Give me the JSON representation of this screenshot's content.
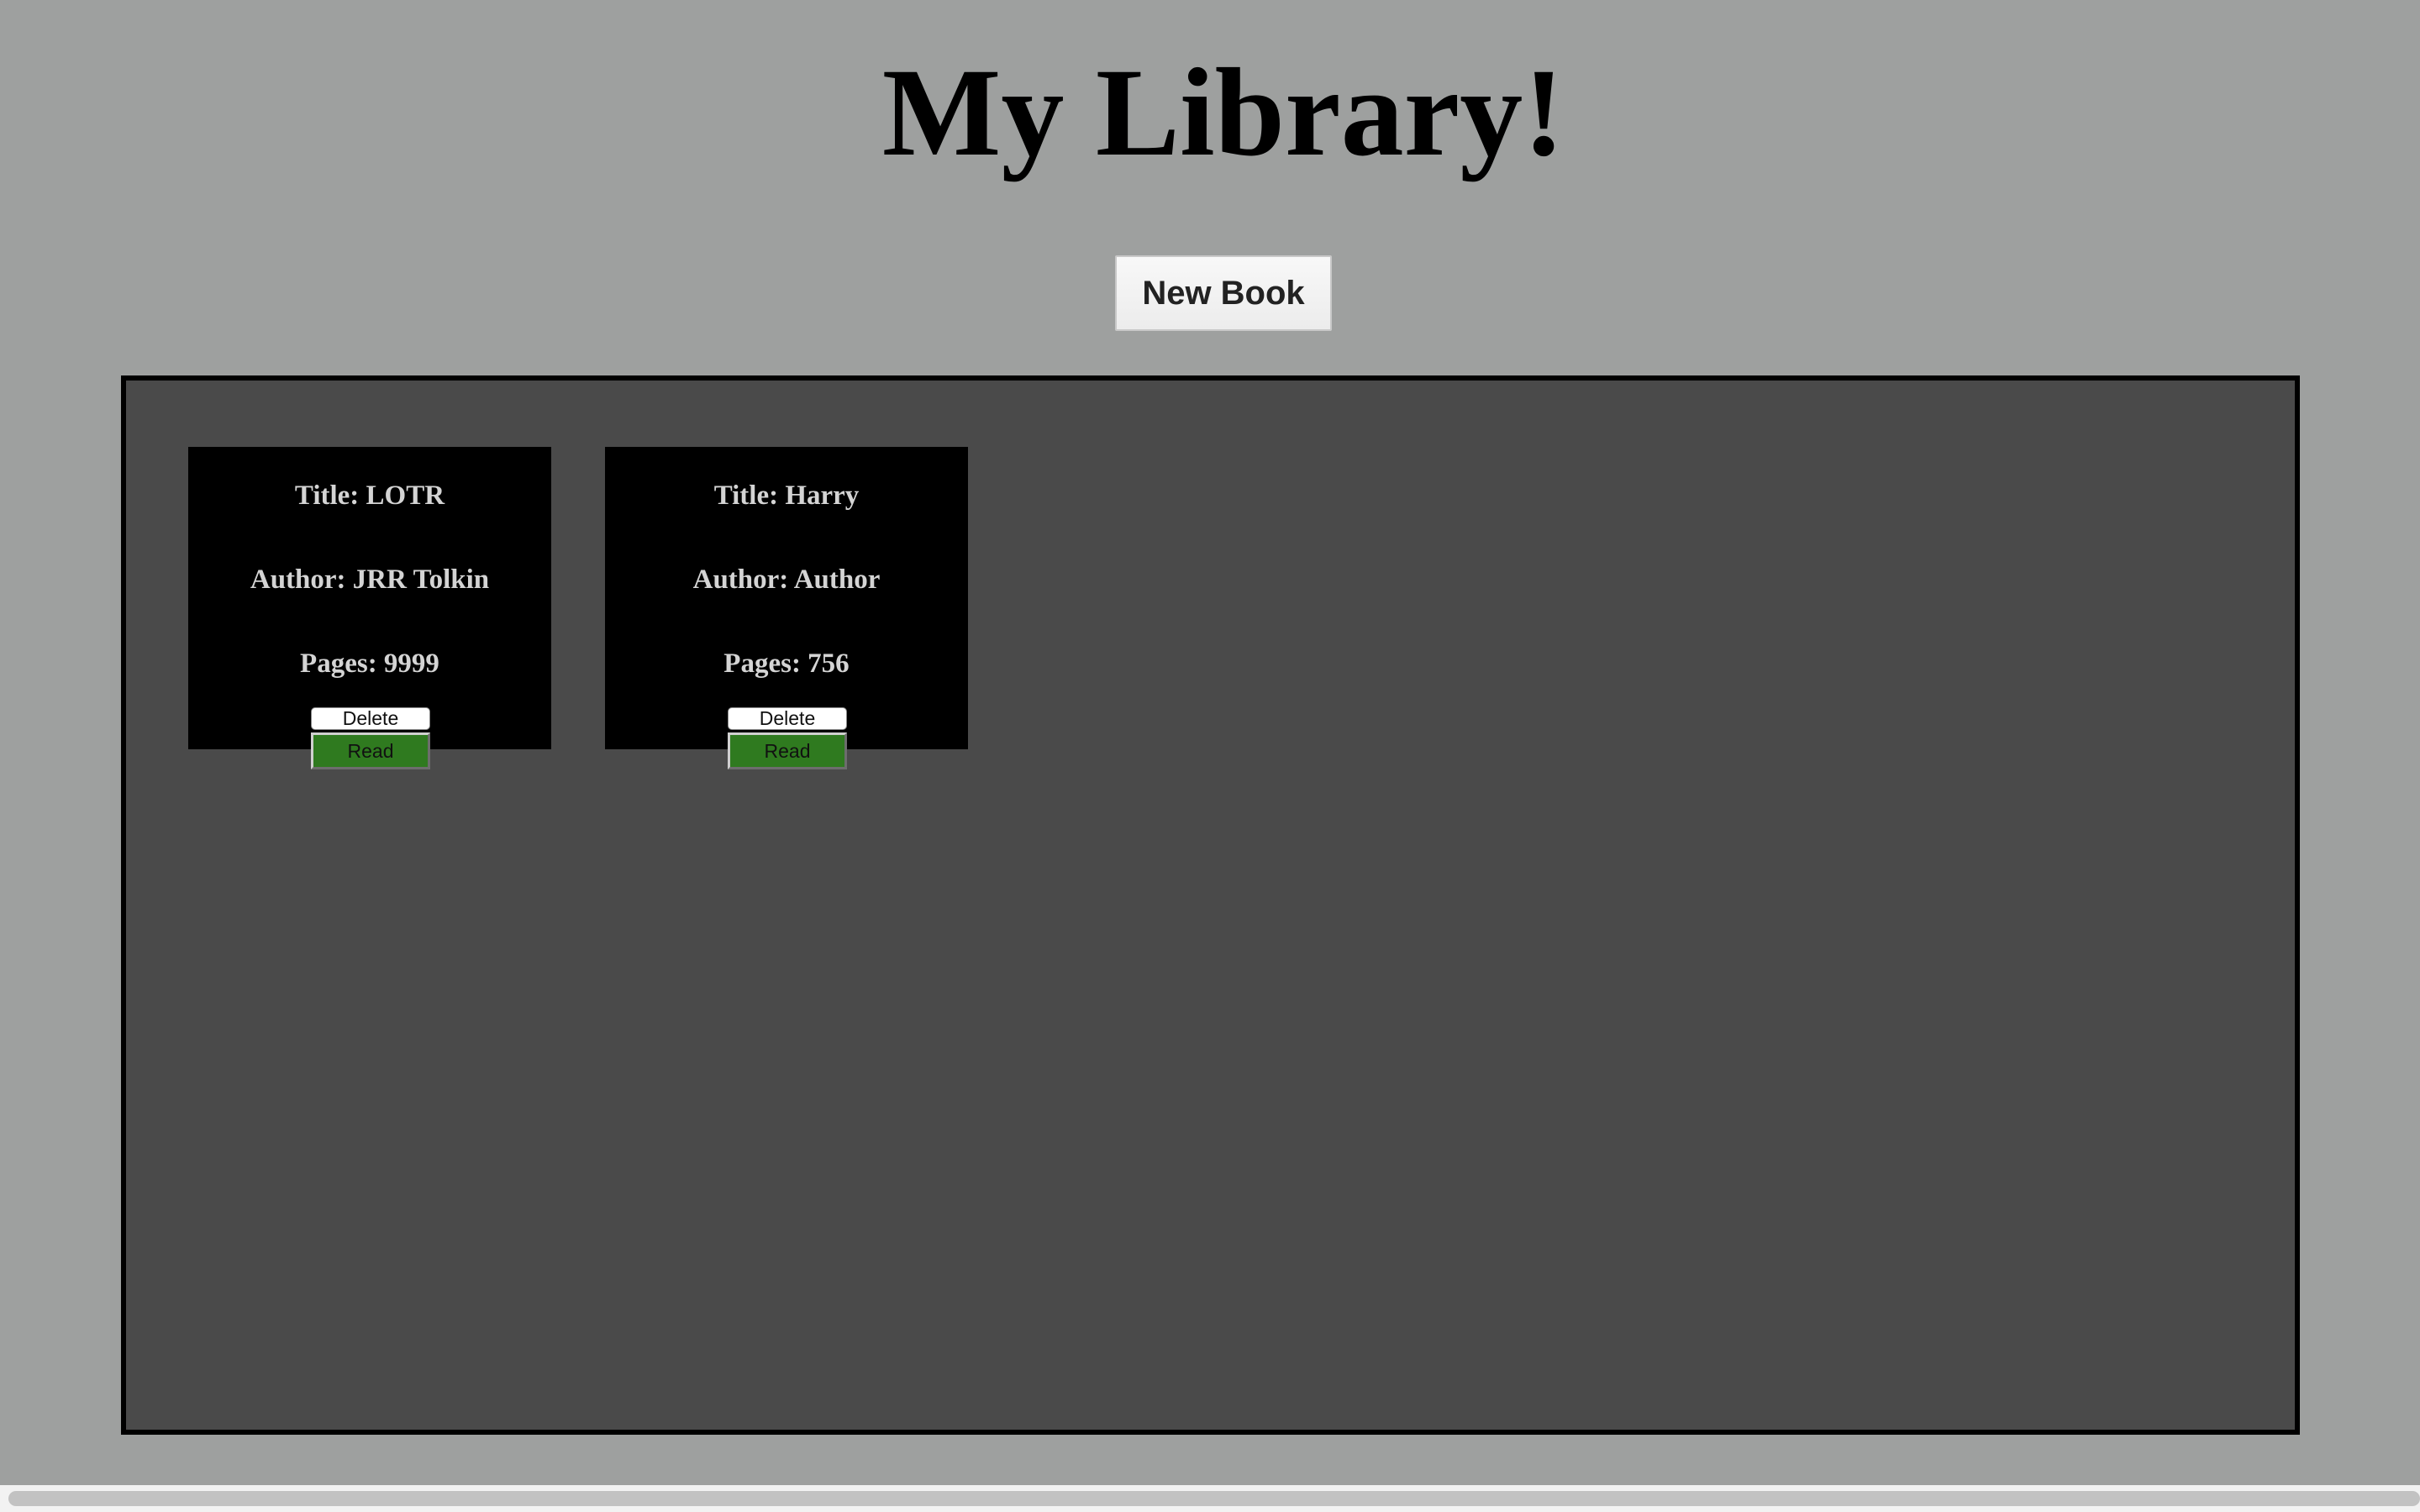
{
  "header": {
    "title": "My Library!"
  },
  "toolbar": {
    "new_book_label": "New Book"
  },
  "books": [
    {
      "title": "Title: LOTR",
      "author": "Author: JRR Tolkin",
      "pages": "Pages: 9999",
      "delete_label": "Delete",
      "read_label": "Read"
    },
    {
      "title": "Title: Harry",
      "author": "Author: Author",
      "pages": "Pages: 756",
      "delete_label": "Delete",
      "read_label": "Read"
    }
  ],
  "colors": {
    "page_background": "#9ea09f",
    "panel_background": "#4a4a4a",
    "card_background": "#000000",
    "card_text": "#d4d4d4",
    "read_button": "#2f7a1f"
  }
}
